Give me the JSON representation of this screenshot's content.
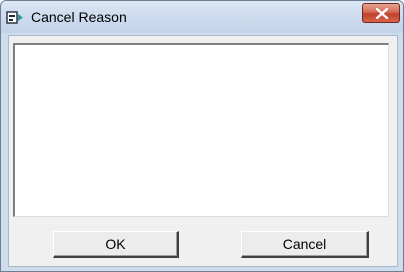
{
  "window": {
    "title": "Cancel Reason",
    "app_icon": "data-entry-form-icon",
    "close_icon": "close-icon"
  },
  "memo": {
    "value": ""
  },
  "buttons": {
    "ok_label": "OK",
    "cancel_label": "Cancel"
  },
  "colors": {
    "titlebar": "#cddbee",
    "close_button": "#c8503a",
    "client_bg": "#f0f0f0"
  }
}
